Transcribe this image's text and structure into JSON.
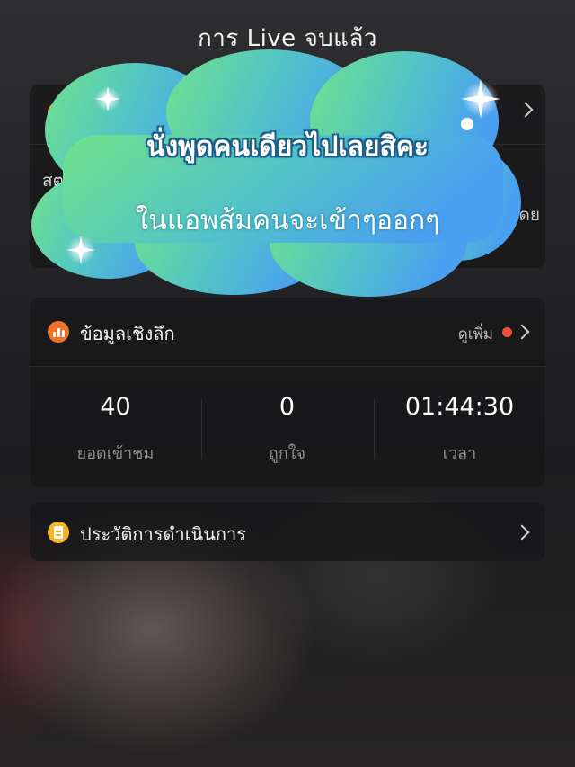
{
  "header": {
    "title": "การ Live จบแล้ว"
  },
  "summary_card": {
    "left_text": "สต",
    "right_text": "่โดย"
  },
  "insights": {
    "title": "ข้อมูลเชิงลึก",
    "more_label": "ดูเพิ่ม",
    "stats": [
      {
        "value": "40",
        "label": "ยอดเข้าชม"
      },
      {
        "value": "0",
        "label": "ถูกใจ"
      },
      {
        "value": "01:44:30",
        "label": "เวลา"
      }
    ]
  },
  "history": {
    "title": "ประวัติการดำเนินการ"
  },
  "overlay": {
    "line1": "นั่งพูดคนเดียวไปเลยสิคะ",
    "line2": "ในแอพส้มคนจะเข้าๆออกๆ"
  },
  "colors": {
    "insight_icon": "#f0732a",
    "history_icon": "#f5b62b",
    "notification_dot": "#f2503c",
    "cloud_start": "#6ee08a",
    "cloud_end": "#4aa8f0"
  }
}
